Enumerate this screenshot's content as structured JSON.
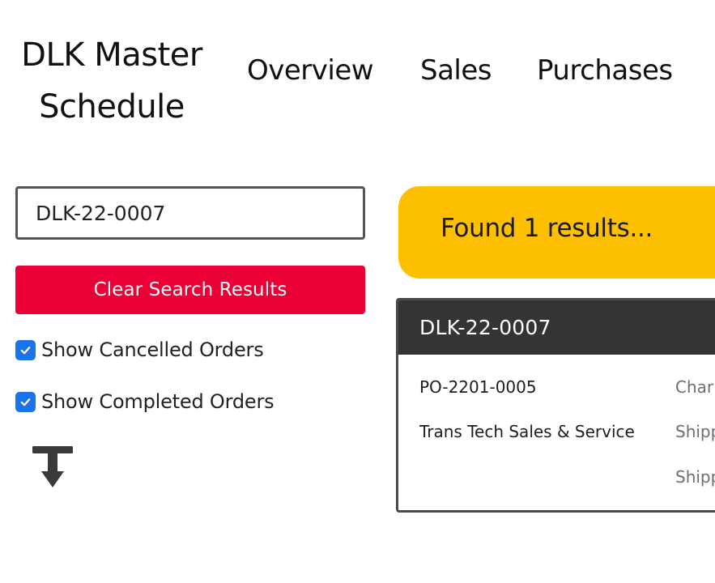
{
  "header": {
    "title": "DLK Master Schedule",
    "nav": {
      "overview": "Overview",
      "sales": "Sales",
      "purchases": "Purchases"
    }
  },
  "search": {
    "value": "DLK-22-0007",
    "clear_label": "Clear Search Results"
  },
  "filters": {
    "show_cancelled": {
      "label": "Show Cancelled Orders",
      "checked": true
    },
    "show_completed": {
      "label": "Show Completed Orders",
      "checked": true
    }
  },
  "results": {
    "message": "Found 1 results..."
  },
  "order_card": {
    "id": "DLK-22-0007",
    "po_number": "PO-2201-0005",
    "vendor": "Trans Tech Sales & Service",
    "right_col": [
      "Char",
      "Shipp",
      "Shipp"
    ]
  },
  "colors": {
    "accent_red": "#ea0034",
    "banner_yellow": "#fcc000",
    "card_header": "#343434",
    "checkbox_blue": "#1a73e8"
  },
  "icons": {
    "download": "download-to-bottom-icon",
    "check": "check-icon"
  }
}
